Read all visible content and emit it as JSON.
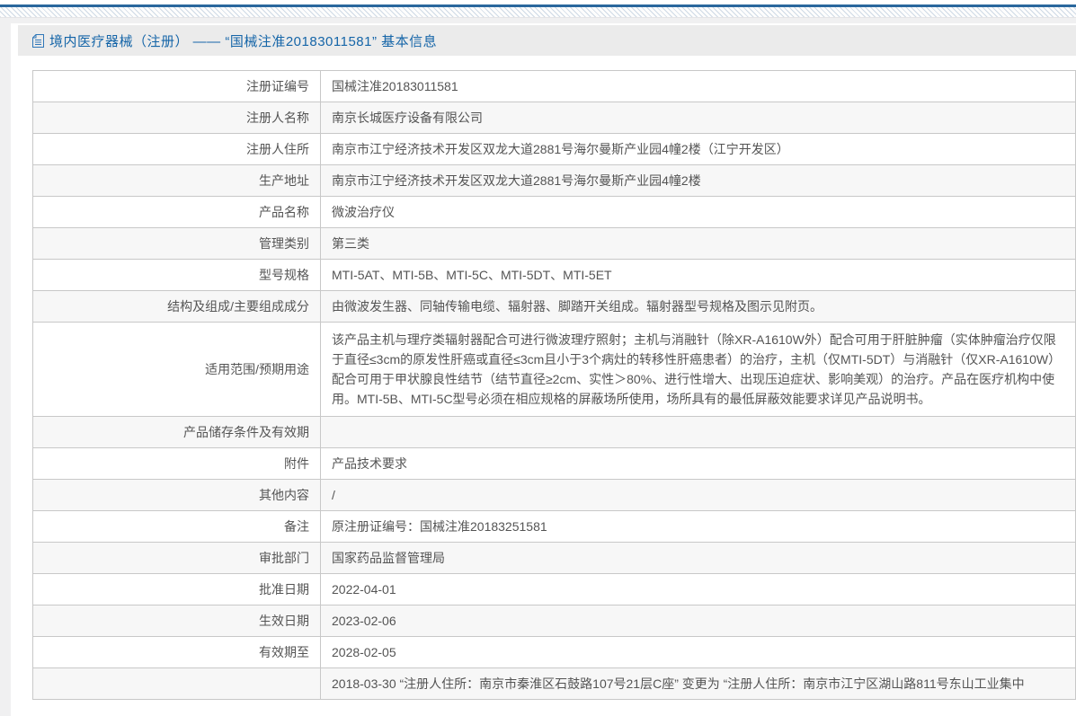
{
  "page": {
    "title": "境内医疗器械（注册） —— “国械注准20183011581” 基本信息"
  },
  "colors": {
    "accent_blue": "#1565a8",
    "top_line_blue": "#2a679d",
    "header_bar_bg": "#ebebeb",
    "alt_row_bg": "#f7f7f7",
    "border_gray": "#c8c8c8",
    "text_gray": "#545454"
  },
  "icons": {
    "title_icon": "document-icon"
  },
  "table": {
    "rows": [
      {
        "label": "注册证编号",
        "value": "国械注准20183011581"
      },
      {
        "label": "注册人名称",
        "value": "南京长城医疗设备有限公司"
      },
      {
        "label": "注册人住所",
        "value": "南京市江宁经济技术开发区双龙大道2881号海尔曼斯产业园4幢2楼（江宁开发区）"
      },
      {
        "label": "生产地址",
        "value": "南京市江宁经济技术开发区双龙大道2881号海尔曼斯产业园4幢2楼"
      },
      {
        "label": "产品名称",
        "value": "微波治疗仪"
      },
      {
        "label": "管理类别",
        "value": "第三类"
      },
      {
        "label": "型号规格",
        "value": "MTI-5AT、MTI-5B、MTI-5C、MTI-5DT、MTI-5ET"
      },
      {
        "label": "结构及组成/主要组成成分",
        "value": "由微波发生器、同轴传输电缆、辐射器、脚踏开关组成。辐射器型号规格及图示见附页。"
      },
      {
        "label": "适用范围/预期用途",
        "value": "该产品主机与理疗类辐射器配合可进行微波理疗照射；主机与消融针（除XR-A1610W外）配合可用于肝脏肿瘤（实体肿瘤治疗仅限于直径≤3cm的原发性肝癌或直径≤3cm且小于3个病灶的转移性肝癌患者）的治疗，主机（仅MTI-5DT）与消融针（仅XR-A1610W）配合可用于甲状腺良性结节（结节直径≥2cm、实性＞80%、进行性增大、出现压迫症状、影响美观）的治疗。产品在医疗机构中使用。MTI-5B、MTI-5C型号必须在相应规格的屏蔽场所使用，场所具有的最低屏蔽效能要求详见产品说明书。"
      },
      {
        "label": "产品储存条件及有效期",
        "value": ""
      },
      {
        "label": "附件",
        "value": "产品技术要求"
      },
      {
        "label": "其他内容",
        "value": "/"
      },
      {
        "label": "备注",
        "value": "原注册证编号：国械注准20183251581"
      },
      {
        "label": "审批部门",
        "value": "国家药品监督管理局"
      },
      {
        "label": "批准日期",
        "value": "2022-04-01"
      },
      {
        "label": "生效日期",
        "value": "2023-02-06"
      },
      {
        "label": "有效期至",
        "value": "2028-02-05"
      },
      {
        "label": "",
        "value": "2018-03-30 “注册人住所：南京市秦淮区石鼓路107号21层C座” 变更为 “注册人住所：南京市江宁区湖山路811号东山工业集中"
      }
    ]
  }
}
